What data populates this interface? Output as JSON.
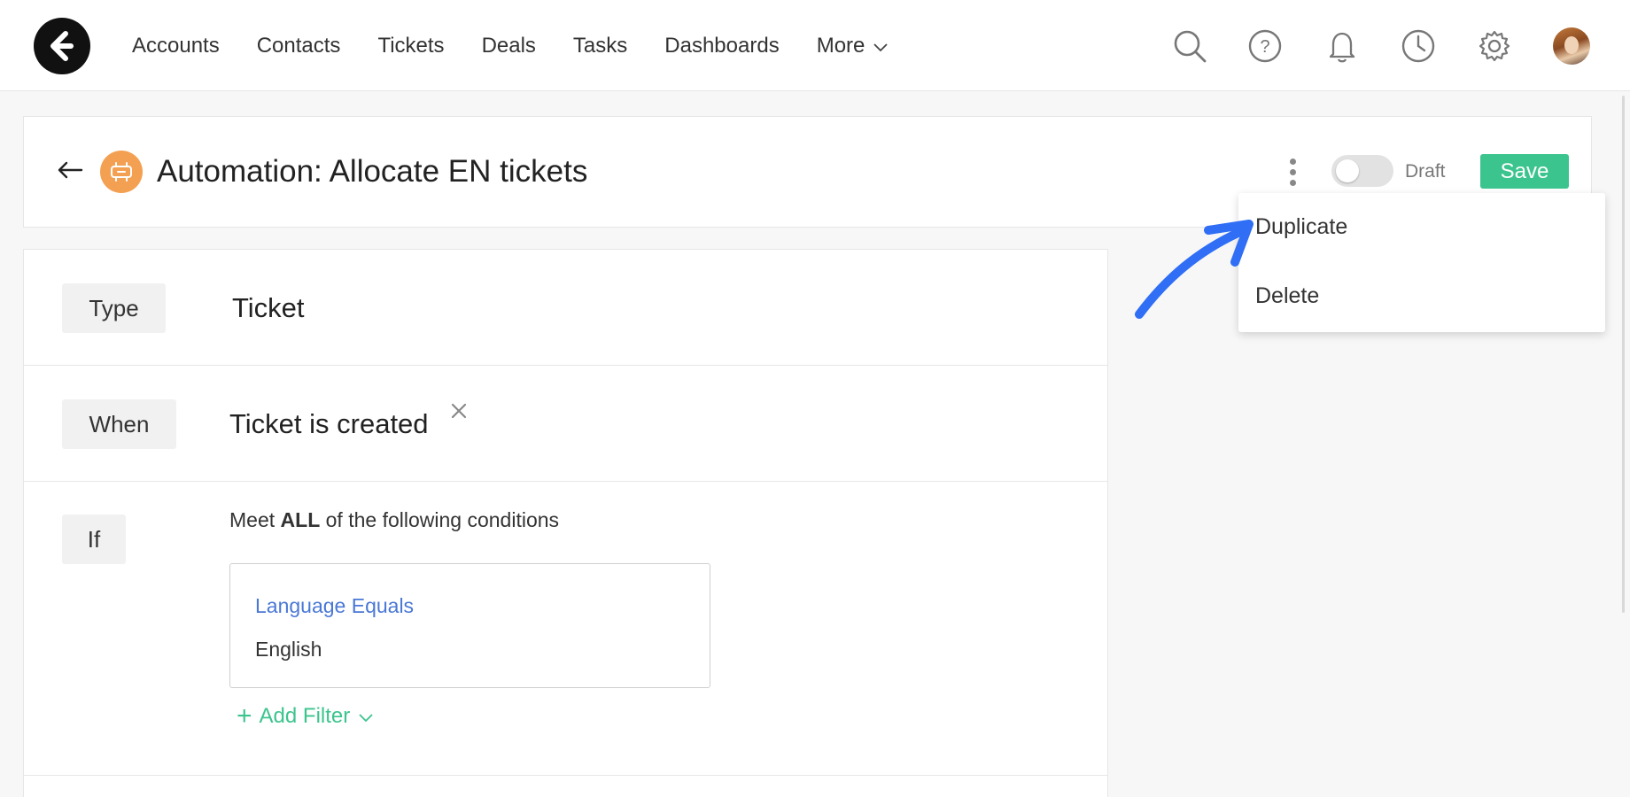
{
  "nav": {
    "items": [
      "Accounts",
      "Contacts",
      "Tickets",
      "Deals",
      "Tasks",
      "Dashboards"
    ],
    "more_label": "More"
  },
  "header": {
    "title": "Automation: Allocate EN tickets",
    "status_label": "Draft",
    "save_label": "Save"
  },
  "menu": {
    "items": [
      "Duplicate",
      "Delete"
    ]
  },
  "rule": {
    "type_tag": "Type",
    "type_value": "Ticket",
    "when_tag": "When",
    "when_value": "Ticket is created",
    "if_tag": "If",
    "cond_prefix": "Meet",
    "cond_bold": "ALL",
    "cond_suffix": "of the following conditions",
    "filter_name": "Language Equals",
    "filter_value": "English",
    "add_filter_label": "Add Filter"
  },
  "colors": {
    "accent_green": "#3cc48e",
    "automation_icon": "#f4a052",
    "link_blue": "#4a78d6",
    "annotation_arrow": "#2f6ef5"
  },
  "icons": [
    "logo-icon",
    "search-icon",
    "help-icon",
    "bell-icon",
    "clock-icon",
    "gear-icon",
    "back-arrow-icon",
    "automation-icon",
    "kebab-menu-icon",
    "close-icon",
    "plus-icon",
    "chevron-down-icon"
  ]
}
